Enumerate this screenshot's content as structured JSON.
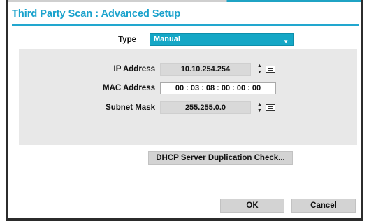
{
  "dialog": {
    "title": "Third Party Scan : Advanced Setup"
  },
  "type_field": {
    "label": "Type",
    "selected": "Manual"
  },
  "network": {
    "ip_label": "IP Address",
    "ip_value": "10.10.254.254",
    "mac_label": "MAC Address",
    "mac_value": "00 : 03 : 08 : 00 : 00 : 00",
    "subnet_label": "Subnet Mask",
    "subnet_value": "255.255.0.0"
  },
  "buttons": {
    "dhcp_check": "DHCP Server Duplication Check...",
    "ok": "OK",
    "cancel": "Cancel"
  },
  "icons": {
    "spinner": "spinner-arrows-icon",
    "keyboard": "keyboard-icon",
    "dropdown": "chevron-down-icon"
  },
  "colors": {
    "accent": "#1aa2cc",
    "select_bg": "#15a7c6",
    "panel_bg": "#e8e8e8",
    "button_bg": "#d3d3d3"
  }
}
